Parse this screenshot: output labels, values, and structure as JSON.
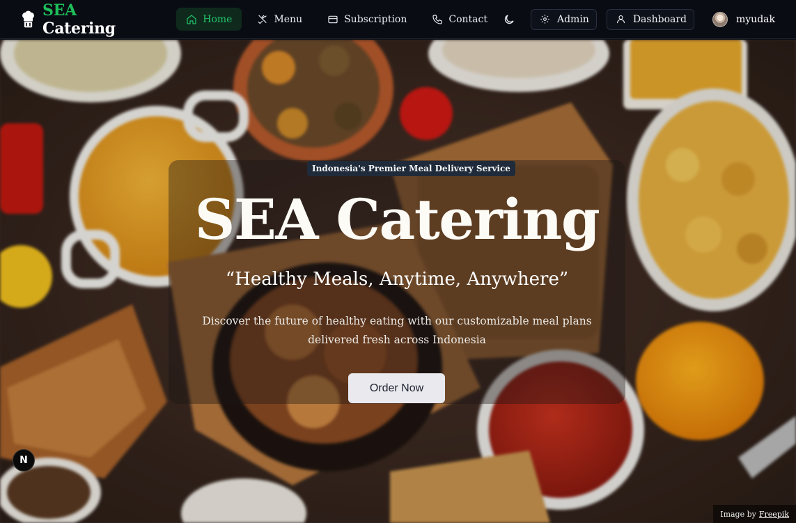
{
  "navbar": {
    "brand": {
      "accent": "SEA",
      "rest": "Catering",
      "accent_color": "#1fbf5a"
    },
    "links": [
      {
        "label": "Home",
        "icon": "home-icon",
        "active": true
      },
      {
        "label": "Menu",
        "icon": "utensils-icon",
        "active": false
      },
      {
        "label": "Subscription",
        "icon": "credit-card-icon",
        "active": false
      },
      {
        "label": "Contact",
        "icon": "phone-icon",
        "active": false
      }
    ],
    "theme_toggle_icon": "moon-icon",
    "admin_label": "Admin",
    "dashboard_label": "Dashboard",
    "username": "myudak"
  },
  "hero": {
    "badge": "Indonesia's Premier Meal Delivery Service",
    "title": "SEA Catering",
    "slogan": "“Healthy Meals, Anytime, Anywhere”",
    "description": "Discover the future of healthy eating with our customizable meal plans delivered fresh across Indonesia",
    "cta": "Order Now",
    "credit_prefix": "Image by",
    "credit_link": "Freepik",
    "next_badge": "N"
  }
}
